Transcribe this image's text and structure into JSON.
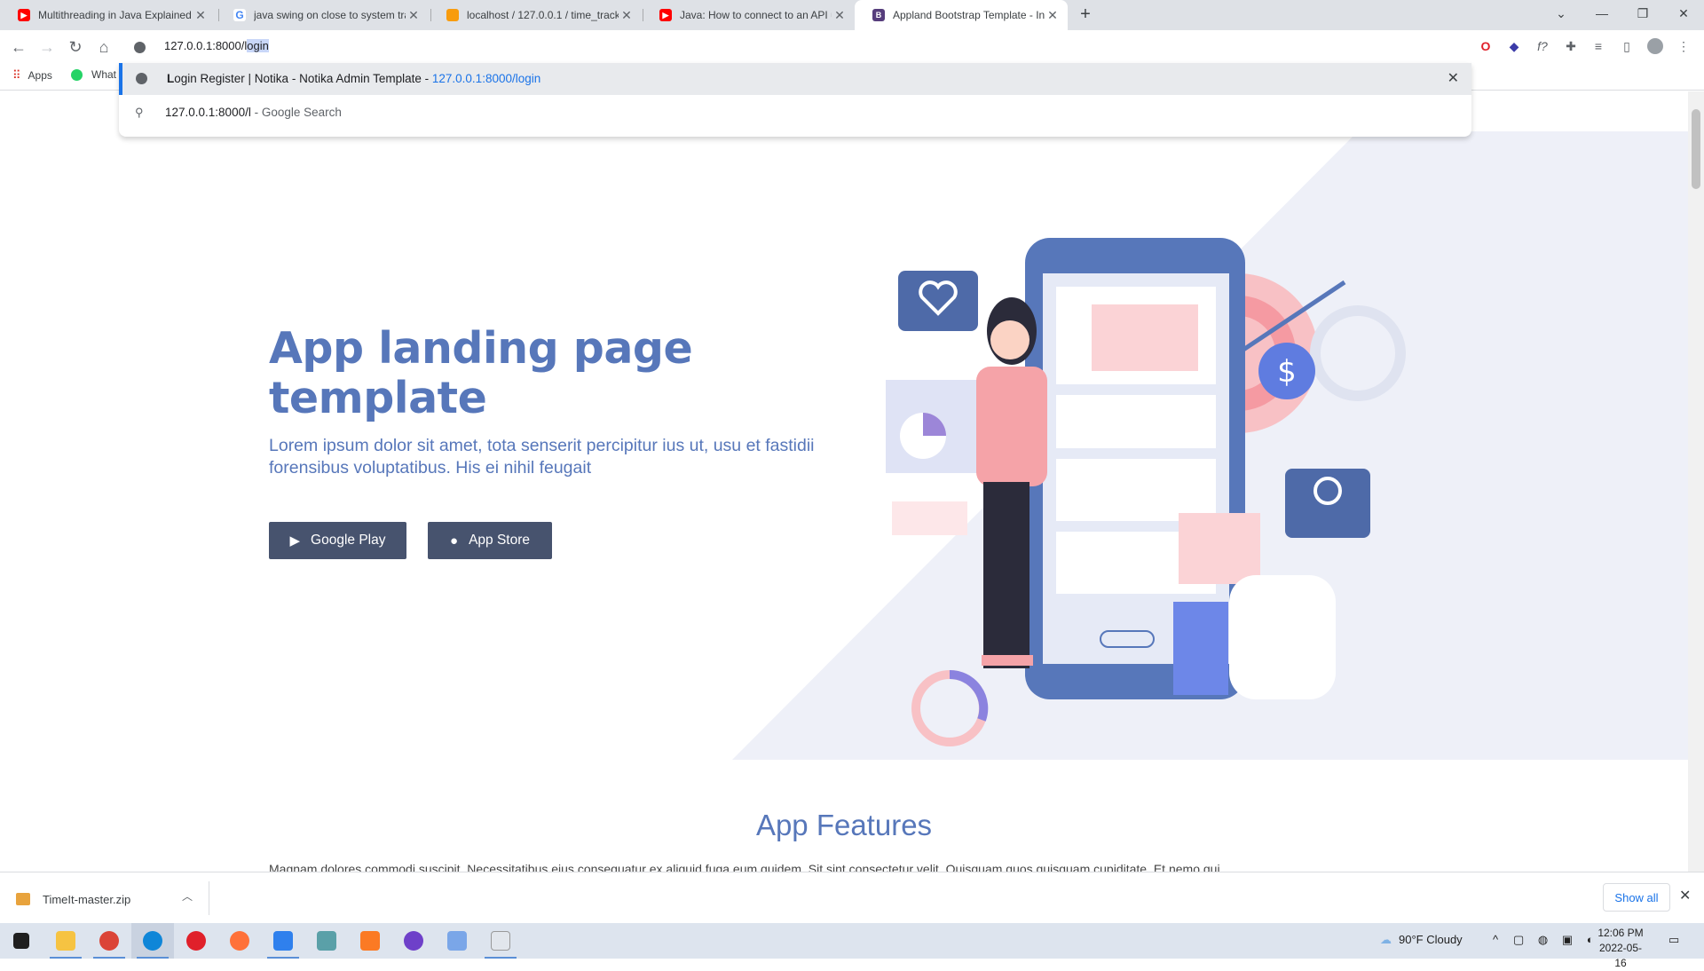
{
  "browser": {
    "tabs": [
      {
        "title": "Multithreading in Java Explained",
        "favicon": "youtube-icon",
        "color": "#ff0000"
      },
      {
        "title": "java swing on close to system tra",
        "favicon": "google-icon",
        "color": "#4285f4"
      },
      {
        "title": "localhost / 127.0.0.1 / time_track",
        "favicon": "phpmyadmin-icon",
        "color": "#f89c0e"
      },
      {
        "title": "Java: How to connect to an API u",
        "favicon": "youtube-icon",
        "color": "#ff0000"
      },
      {
        "title": "Appland Bootstrap Template - In",
        "favicon": "bootstrap-icon",
        "color": "#563d7c"
      }
    ],
    "address": {
      "typed": "127.0.0.1:8000/l",
      "autocomplete": "ogin"
    },
    "bookmarks": [
      {
        "label": "Apps"
      },
      {
        "label": "What"
      }
    ],
    "suggestions": [
      {
        "title_first": "L",
        "title_rest": "ogin Register | Notika - Notika Admin Template",
        "separator": " - ",
        "url": "127.0.0.1:8000/login"
      },
      {
        "query": "127.0.0.1:8000/l",
        "hint": " - Google Search"
      }
    ]
  },
  "page": {
    "hero_title": "App landing page template",
    "hero_subtitle": "Lorem ipsum dolor sit amet, tota senserit percipitur ius ut, usu et fastidii forensibus voluptatibus. His ei nihil feugait",
    "google_play_label": "Google Play",
    "app_store_label": "App Store",
    "features_title": "App Features",
    "features_text_partial": "Magnam dolores commodi suscipit. Necessitatibus eius consequatur ex aliquid fuga eum quidem. Sit sint consectetur velit. Quisquam quos quisquam cupiditate. Et nemo qui",
    "accent_color": "#5777ba",
    "button_color": "#47536e"
  },
  "downloads": {
    "file": "TimeIt-master.zip",
    "show_all": "Show all"
  },
  "taskbar": {
    "weather": "90°F  Cloudy",
    "time": "12:06 PM",
    "date": "2022-05-16"
  }
}
